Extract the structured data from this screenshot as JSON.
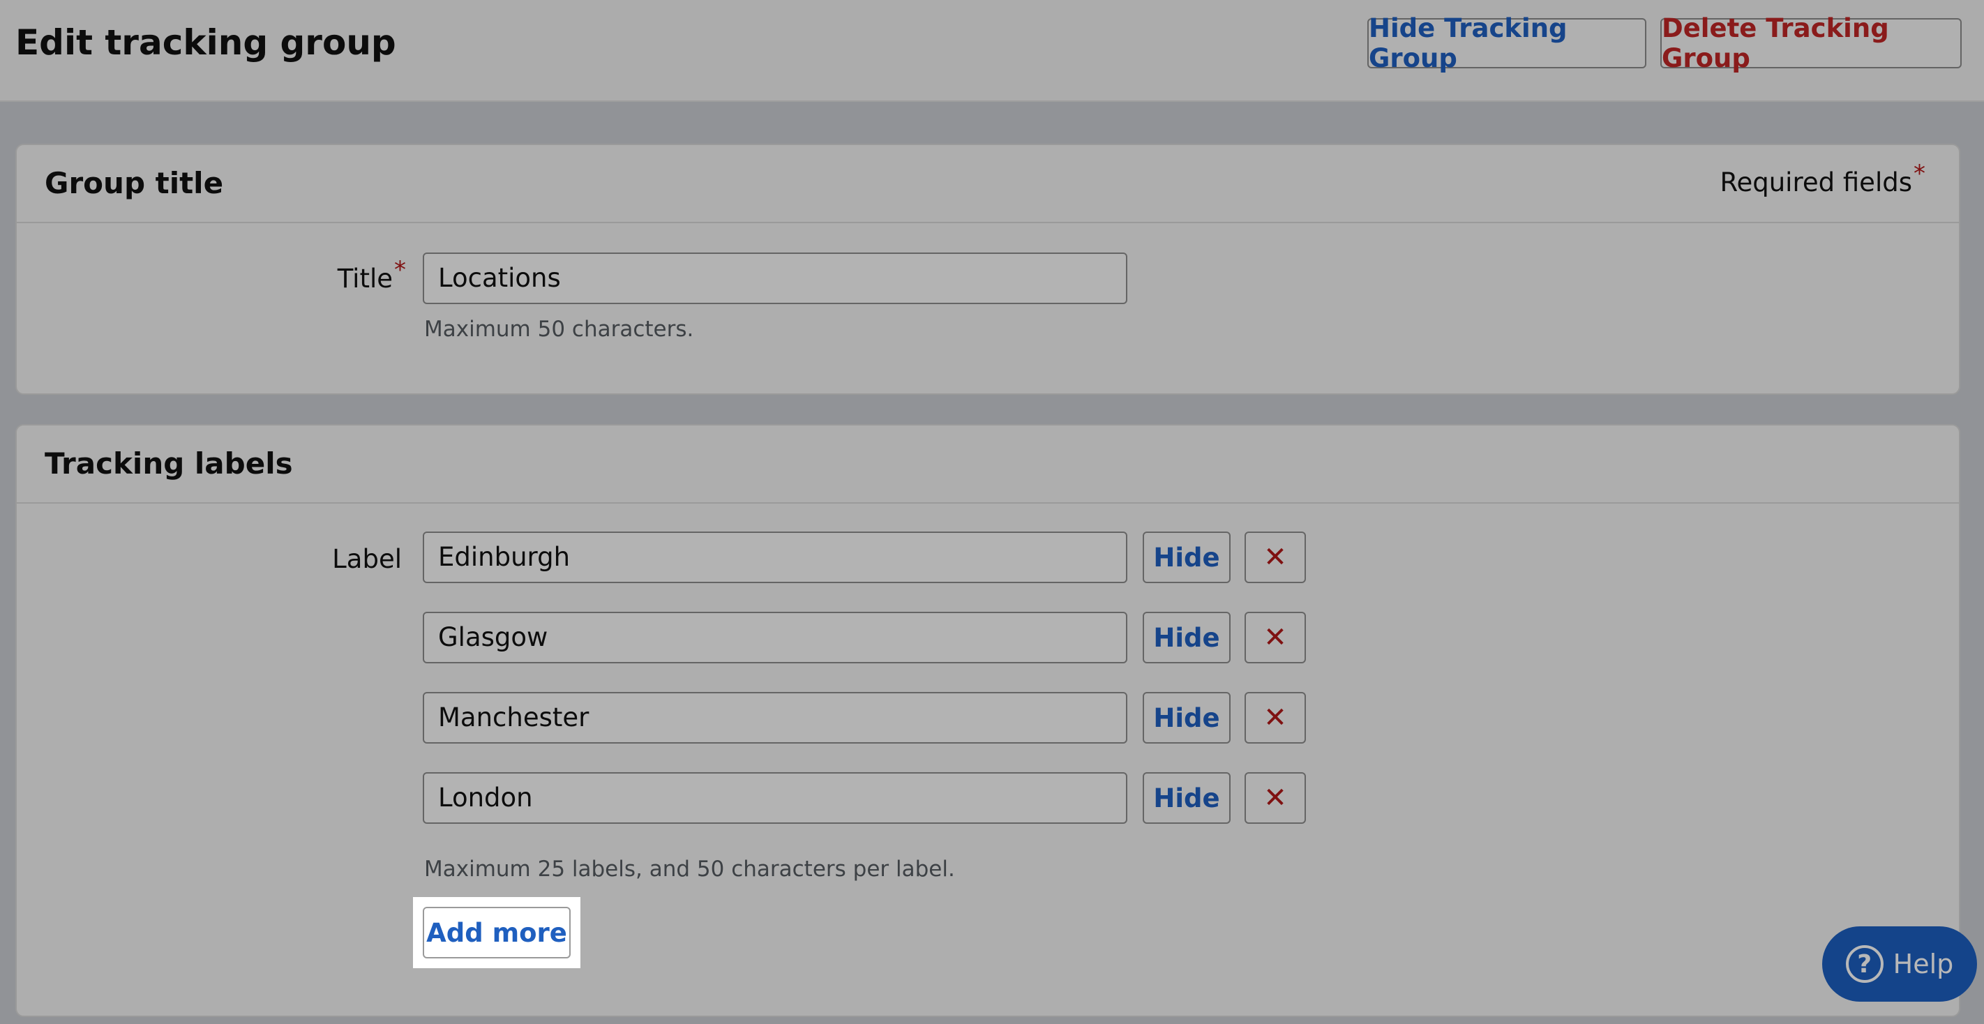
{
  "header": {
    "title": "Edit tracking group",
    "hide_group_label": "Hide Tracking Group",
    "delete_group_label": "Delete Tracking Group"
  },
  "group_section": {
    "heading": "Group title",
    "required_note": "Required fields",
    "required_marker": "*",
    "title_label": "Title",
    "title_value": "Locations",
    "title_hint": "Maximum 50 characters."
  },
  "labels_section": {
    "heading": "Tracking labels",
    "label_text": "Label",
    "labels": [
      {
        "value": "Edinburgh",
        "hide_label": "Hide",
        "remove_icon": "✕"
      },
      {
        "value": "Glasgow",
        "hide_label": "Hide",
        "remove_icon": "✕"
      },
      {
        "value": "Manchester",
        "hide_label": "Hide",
        "remove_icon": "✕"
      },
      {
        "value": "London",
        "hide_label": "Hide",
        "remove_icon": "✕"
      }
    ],
    "hint": "Maximum 25 labels, and 50 characters per label.",
    "add_more_label": "Add more"
  },
  "help": {
    "label": "Help",
    "icon_glyph": "?"
  },
  "colors": {
    "link_blue": "#1f5fbf",
    "danger_red": "#c02626",
    "help_blue": "#1c5fbf"
  }
}
